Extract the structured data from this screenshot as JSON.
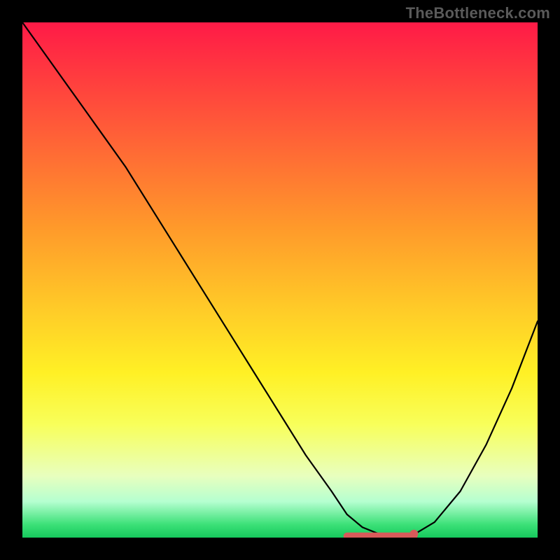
{
  "watermark": "TheBottleneck.com",
  "chart_data": {
    "type": "line",
    "title": "",
    "xlabel": "",
    "ylabel": "",
    "xlim": [
      0,
      100
    ],
    "ylim": [
      0,
      100
    ],
    "x": [
      0,
      5,
      10,
      15,
      20,
      25,
      30,
      35,
      40,
      45,
      50,
      55,
      60,
      63,
      66,
      69,
      72,
      74,
      76,
      80,
      85,
      90,
      95,
      100
    ],
    "values": [
      100,
      93,
      86,
      79,
      72,
      64,
      56,
      48,
      40,
      32,
      24,
      16,
      9,
      4.5,
      2,
      0.8,
      0.3,
      0.2,
      0.6,
      3,
      9,
      18,
      29,
      42
    ],
    "trough": {
      "x_start": 63,
      "x_end": 76,
      "y": 0.3
    },
    "colors": {
      "curve": "#000000",
      "trough_highlight": "#d85a5a",
      "gradient_top": "#ff1a47",
      "gradient_bottom": "#16c95d",
      "frame": "#000000"
    }
  }
}
